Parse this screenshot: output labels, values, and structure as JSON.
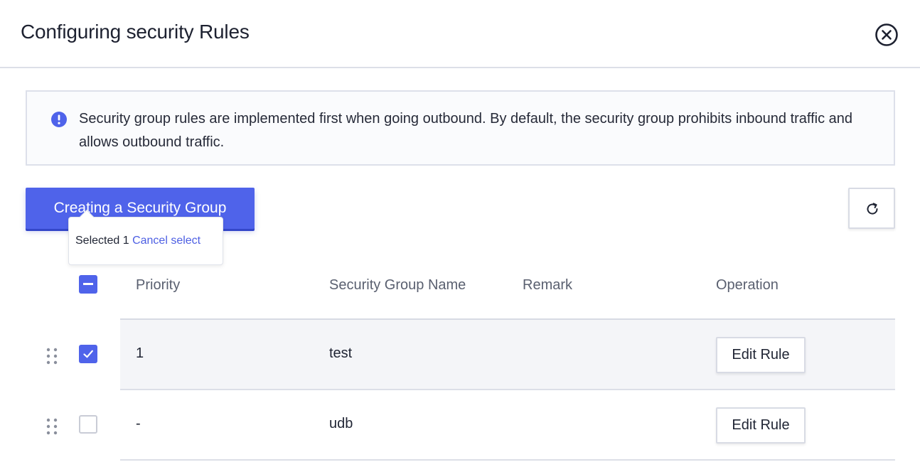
{
  "dialog": {
    "title": "Configuring security Rules",
    "close_icon": "close-circle-icon"
  },
  "notice": {
    "icon": "info-circle-icon",
    "text": "Security group rules are implemented first when going outbound. By default, the security group prohibits inbound traffic and allows outbound traffic."
  },
  "toolbar": {
    "create_label": "Creating a Security Group",
    "refresh_icon": "refresh-icon"
  },
  "selection": {
    "selected_text": "Selected 1",
    "cancel_label": "Cancel select"
  },
  "table": {
    "columns": [
      "Priority",
      "Security Group Name",
      "Remark",
      "Operation"
    ],
    "rows": [
      {
        "priority": "1",
        "name": "test",
        "remark": "",
        "action": "Edit Rule",
        "checked": true
      },
      {
        "priority": "-",
        "name": "udb",
        "remark": "",
        "action": "Edit Rule",
        "checked": false
      }
    ]
  },
  "colors": {
    "accent": "#4f63ea",
    "selected_row": "#f4f5f8"
  }
}
